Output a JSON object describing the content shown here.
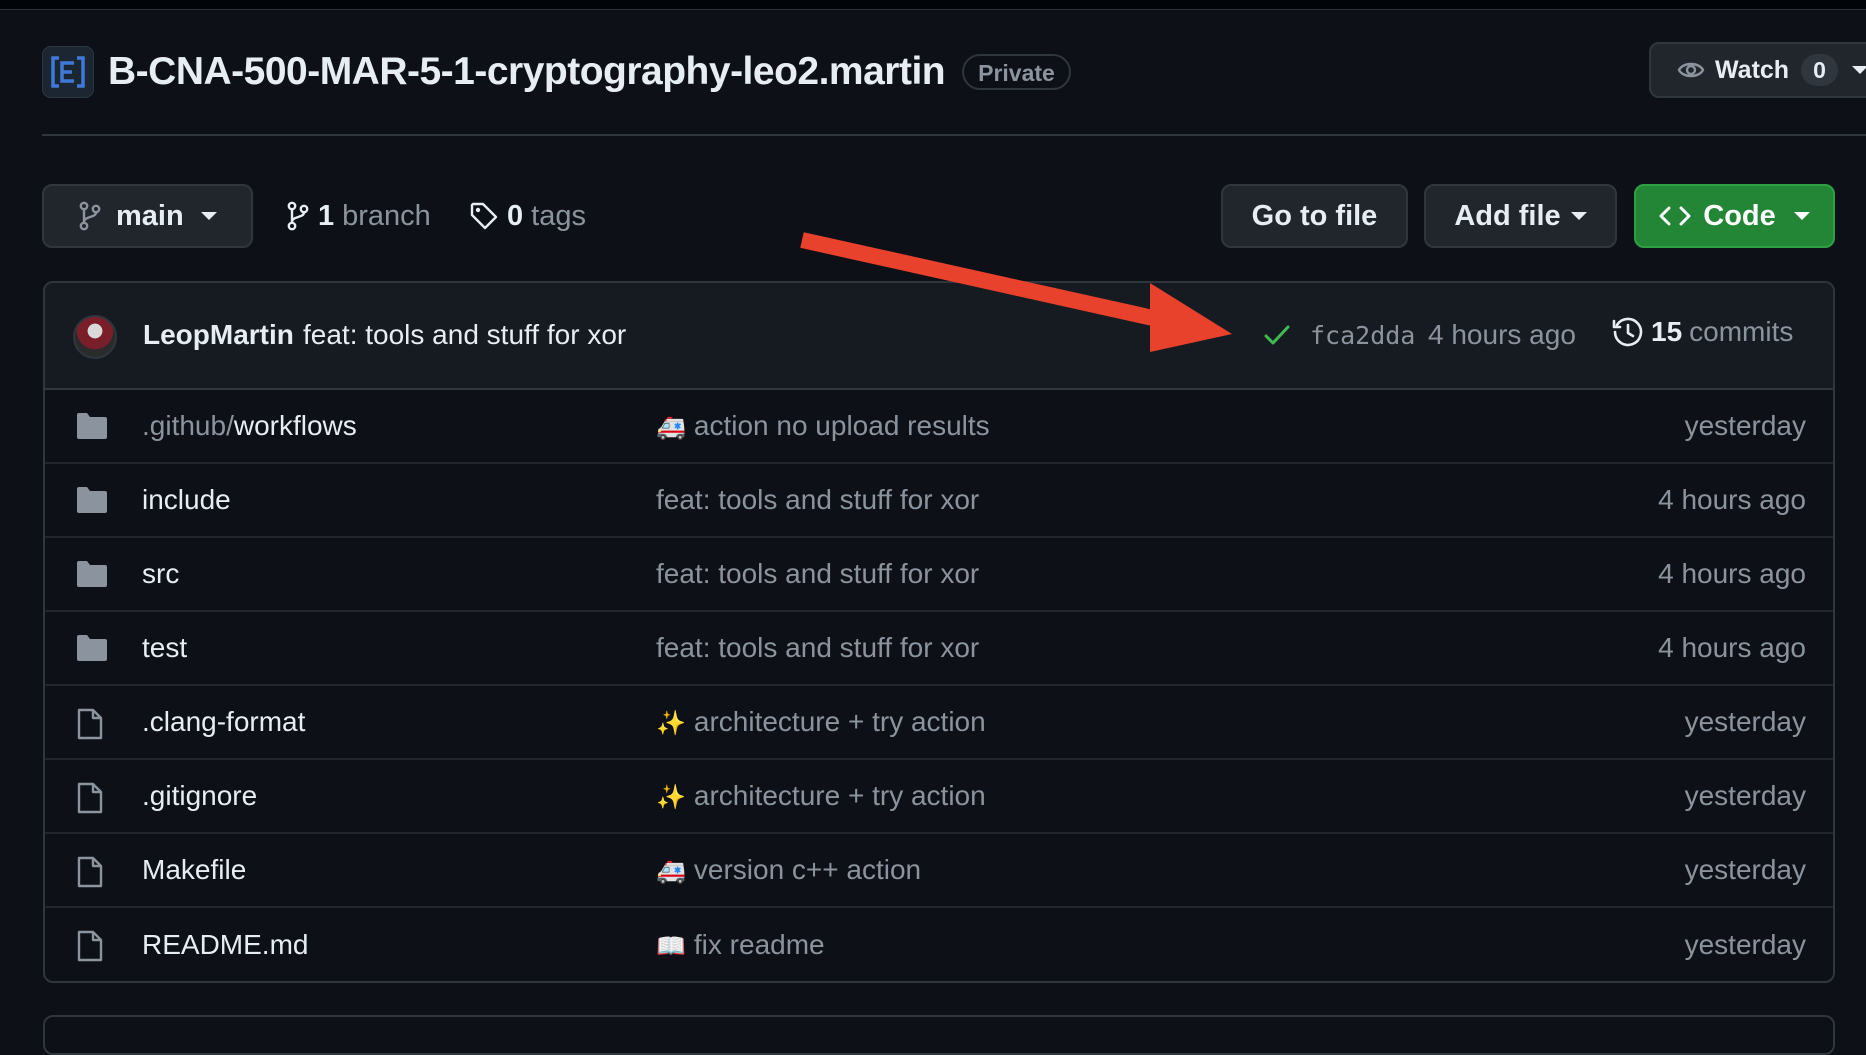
{
  "repo": {
    "name": "B-CNA-500-MAR-5-1-cryptography-leo2.martin",
    "visibility": "Private",
    "avatar_icon": "epitech-logo-icon"
  },
  "watch": {
    "label": "Watch",
    "count": "0"
  },
  "toolbar": {
    "branch_name": "main",
    "branch_count": "1",
    "branch_label": "branch",
    "tag_count": "0",
    "tag_label": "tags",
    "goto_file": "Go to file",
    "add_file": "Add file",
    "code": "Code"
  },
  "latest_commit": {
    "author": "LeopMartin",
    "message": "feat: tools and stuff for xor",
    "sha": "fca2dda",
    "time": "4 hours ago",
    "commit_count": "15",
    "commit_label": "commits",
    "status": "success"
  },
  "files": [
    {
      "type": "dir",
      "prefix": ".github/",
      "name": "workflows",
      "emoji": "🚑",
      "message": "action no upload results",
      "time": "yesterday"
    },
    {
      "type": "dir",
      "prefix": "",
      "name": "include",
      "emoji": "",
      "message": "feat: tools and stuff for xor",
      "time": "4 hours ago"
    },
    {
      "type": "dir",
      "prefix": "",
      "name": "src",
      "emoji": "",
      "message": "feat: tools and stuff for xor",
      "time": "4 hours ago"
    },
    {
      "type": "dir",
      "prefix": "",
      "name": "test",
      "emoji": "",
      "message": "feat: tools and stuff for xor",
      "time": "4 hours ago"
    },
    {
      "type": "file",
      "prefix": "",
      "name": ".clang-format",
      "emoji": "✨",
      "message": "architecture + try action",
      "time": "yesterday"
    },
    {
      "type": "file",
      "prefix": "",
      "name": ".gitignore",
      "emoji": "✨",
      "message": "architecture + try action",
      "time": "yesterday"
    },
    {
      "type": "file",
      "prefix": "",
      "name": "Makefile",
      "emoji": "🚑",
      "message": "version c++ action",
      "time": "yesterday"
    },
    {
      "type": "file",
      "prefix": "",
      "name": "README.md",
      "emoji": "📖",
      "message": "fix readme",
      "time": "yesterday"
    }
  ],
  "colors": {
    "background": "#0d1117",
    "code_button": "#238636",
    "annotation_arrow": "#e8412c",
    "check": "#3fb950"
  }
}
